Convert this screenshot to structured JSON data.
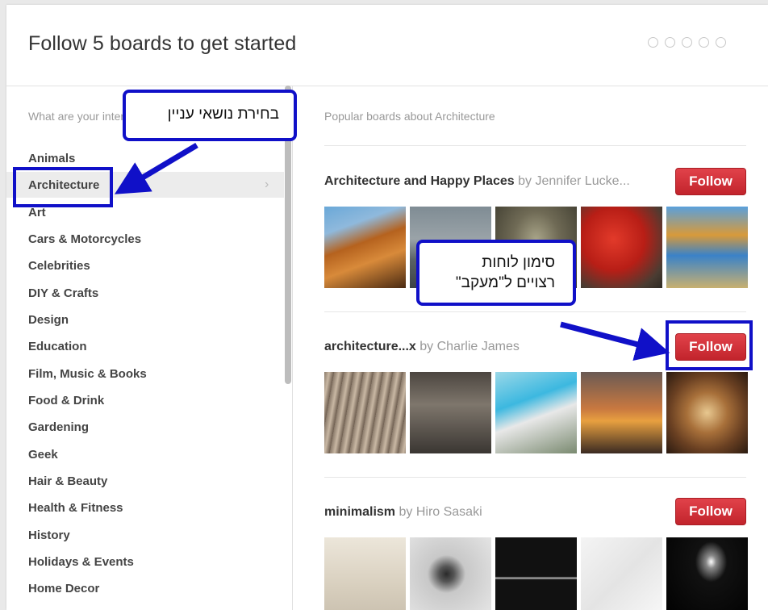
{
  "header": {
    "title": "Follow 5 boards to get started",
    "progress_dots": 5
  },
  "left_panel": {
    "prompt": "What are your interests?",
    "categories": [
      "Animals",
      "Architecture",
      "Art",
      "Cars & Motorcycles",
      "Celebrities",
      "DIY & Crafts",
      "Design",
      "Education",
      "Film, Music & Books",
      "Food & Drink",
      "Gardening",
      "Geek",
      "Hair & Beauty",
      "Health & Fitness",
      "History",
      "Holidays & Events",
      "Home Decor"
    ],
    "selected": "Architecture"
  },
  "right_panel": {
    "heading": "Popular boards about Architecture",
    "boards": [
      {
        "name": "Architecture and Happy Places",
        "by": "by Jennifer Lucke...",
        "button": "Follow"
      },
      {
        "name": "architecture...x",
        "by": "by Charlie James",
        "button": "Follow"
      },
      {
        "name": "minimalism",
        "by": "by Hiro Sasaki",
        "button": "Follow"
      }
    ]
  },
  "annotations": {
    "choose_interest": "בחירת נושאי עניין",
    "mark_boards_line1": "סימון לוחות",
    "mark_boards_line2": "רצויים ל\"מעקב\""
  },
  "colors": {
    "follow_button": "#cb2d35",
    "annotation_border": "#1010c8"
  }
}
